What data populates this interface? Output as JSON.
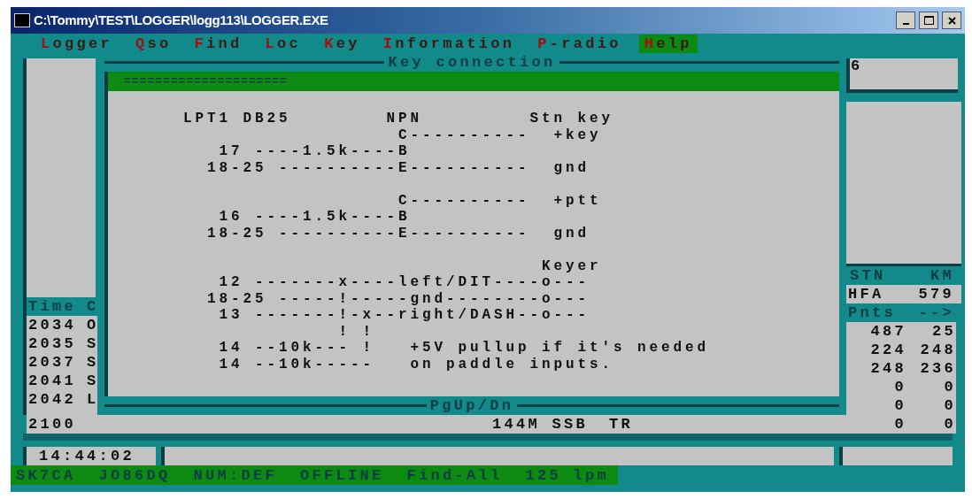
{
  "window": {
    "title": "C:\\Tommy\\TEST\\LOGGER\\logg113\\LOGGER.EXE"
  },
  "menu": [
    {
      "label": "Logger",
      "selected": false
    },
    {
      "label": "Qso",
      "selected": false
    },
    {
      "label": "Find",
      "selected": false
    },
    {
      "label": "Loc",
      "selected": false
    },
    {
      "label": "Key",
      "selected": false
    },
    {
      "label": "Information",
      "selected": false
    },
    {
      "label": "P-radio",
      "selected": false
    },
    {
      "label": "Help",
      "selected": true
    }
  ],
  "log_panel": {
    "columns": [
      "Time",
      "C"
    ],
    "rows": [
      {
        "time": "2034",
        "c": "O"
      },
      {
        "time": "2035",
        "c": "S"
      },
      {
        "time": "2037",
        "c": "S"
      },
      {
        "time": "2041",
        "c": "S"
      },
      {
        "time": "2042",
        "c": "L"
      }
    ]
  },
  "bottom_row": {
    "time": "2100",
    "band_mode": "144M SSB",
    "op_mode": "TR"
  },
  "dialog": {
    "title": "Key connection",
    "header_bar": "=====================",
    "blocks": [
      [
        "      LPT1 DB25        NPN         Stn key",
        "                        C----------  +key",
        "         17 ----1.5k----B",
        "        18-25 ----------E----------  gnd"
      ],
      [
        "                        C----------  +ptt",
        "         16 ----1.5k----B",
        "        18-25 ----------E----------  gnd"
      ],
      [
        "                                    Keyer",
        "         12 -------x----left/DIT----o---",
        "        18-25 -----!-----gnd--------o---",
        "         13 -------!-x--right/DASH--o---",
        "                   ! !",
        "         14 --10k--- !   +5V pullup if it's needed",
        "         14 --10k-----   on paddle inputs."
      ]
    ],
    "footer": "PgUp/Dn"
  },
  "right_panel": {
    "top_value": "6",
    "columns": [
      "STN",
      "KM"
    ],
    "station": {
      "stn": "HFA",
      "km": "579"
    },
    "points_label": "Pnts",
    "points_arrow": "-->",
    "points": [
      [
        "487",
        "25"
      ],
      [
        "224",
        "248"
      ],
      [
        "248",
        "236"
      ],
      [
        "0",
        "0"
      ],
      [
        "0",
        "0"
      ],
      [
        "0",
        "0"
      ]
    ]
  },
  "status": {
    "time": "14:44:02",
    "items": [
      "SK7CA",
      "JO86DQ",
      "NUM:DEF",
      "OFFLINE",
      "Find-All",
      "125 lpm"
    ]
  }
}
